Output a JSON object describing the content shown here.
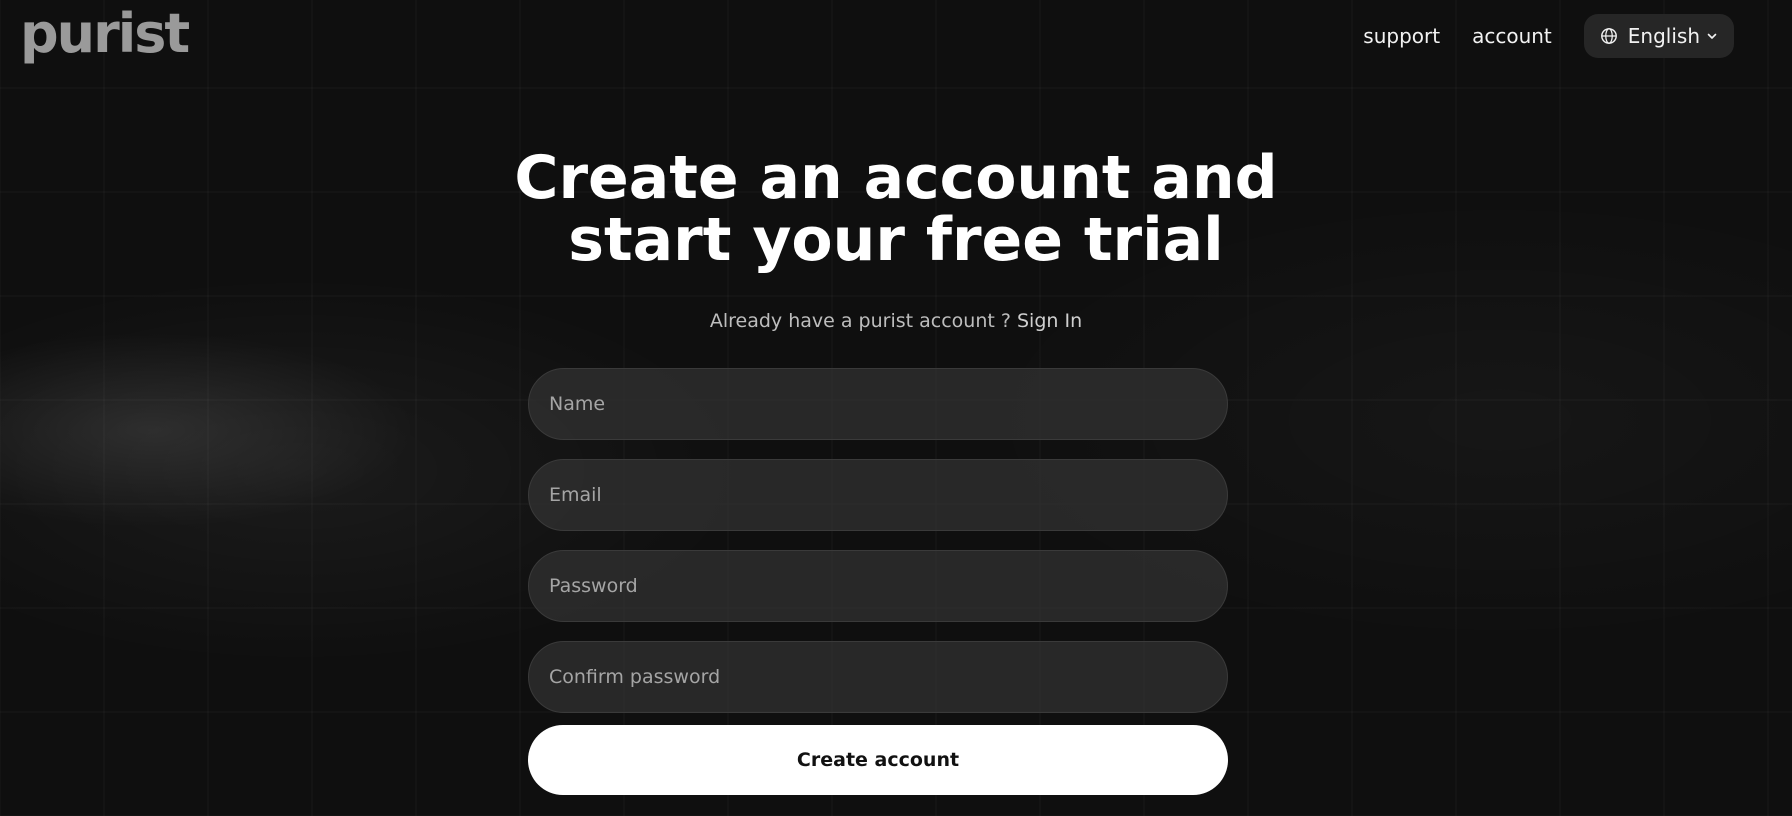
{
  "header": {
    "logo_text": "purist",
    "nav": {
      "support_label": "support",
      "account_label": "account"
    },
    "language": {
      "selected": "English",
      "icon": "globe-icon",
      "dropdown_icon": "chevron-down-icon"
    }
  },
  "main": {
    "title_line1": "Create an account and",
    "title_line2": "start your free trial",
    "subtitle_prefix": "Already have a purist account ?",
    "signin_label": "Sign In",
    "fields": {
      "name": {
        "placeholder": "Name",
        "value": ""
      },
      "email": {
        "placeholder": "Email",
        "value": ""
      },
      "password": {
        "placeholder": "Password",
        "value": ""
      },
      "confirm_password": {
        "placeholder": "Confirm password",
        "value": ""
      }
    },
    "submit_label": "Create account"
  },
  "colors": {
    "background": "#0f0f0f",
    "button": "#ffffff",
    "field": "#2d2d2d",
    "logo": "#9a9a9a"
  }
}
